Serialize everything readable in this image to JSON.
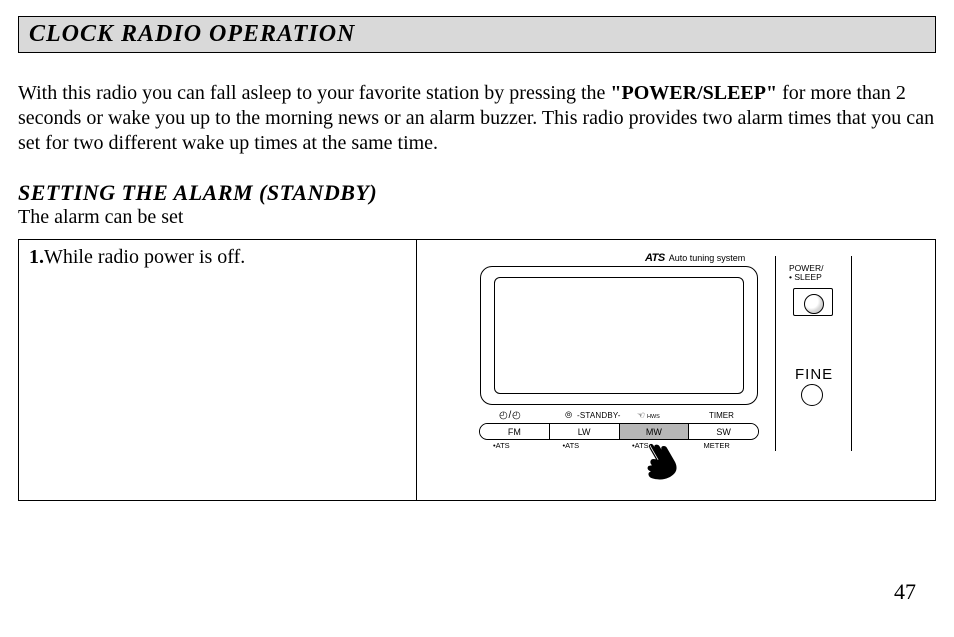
{
  "section_title": "CLOCK RADIO OPERATION",
  "intro": {
    "pre": "With this radio you can fall asleep to your favorite station by pressing the ",
    "bold": "\"POWER/SLEEP\"",
    "post": " for more than 2 seconds or wake you up to the morning news or an alarm buzzer. This radio provides two alarm times that you can set for two different wake up times at the same time."
  },
  "sub_heading": "SETTING THE ALARM (STANDBY)",
  "sub_intro": "The alarm can be set",
  "step": {
    "num": "1.",
    "text": "While radio power is off."
  },
  "radio": {
    "ats_bold": "ATS",
    "ats_text": "Auto tuning system",
    "power_label_1": "POWER/",
    "power_label_2": "• SLEEP",
    "fine": "FINE",
    "icons": {
      "clock": "◴ / ◴",
      "standby_icon": "⦾",
      "standby": "-STANDBY-",
      "hws_icon": "☜",
      "hws_sub": "HWS",
      "timer": "TIMER"
    },
    "bands": [
      "FM",
      "LW",
      "MW",
      "SW"
    ],
    "active_band_index": 2,
    "sublabels": [
      "•ATS",
      "•ATS",
      "•ATS",
      "METER"
    ]
  },
  "page_number": "47"
}
